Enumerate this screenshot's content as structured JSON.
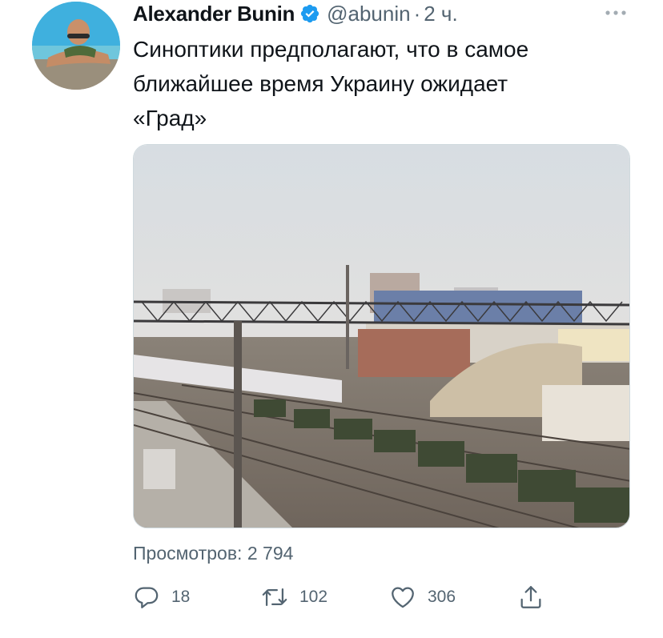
{
  "tweet": {
    "author_name": "Alexander Bunin",
    "handle": "@abunin",
    "separator": "·",
    "time": "2 ч.",
    "text": "Синоптики предполагают, что в самое\nближайшее время Украину ожидает\n«Град»",
    "views_label": "Просмотров:",
    "views_count": "2 794"
  },
  "actions": {
    "reply_count": "18",
    "retweet_count": "102",
    "like_count": "306"
  },
  "icons": {
    "verified": "verified-badge-icon",
    "more": "more-dots-icon",
    "reply": "reply-bubble-icon",
    "retweet": "retweet-arrows-icon",
    "like": "heart-icon",
    "share": "share-upload-icon"
  },
  "colors": {
    "text_primary": "#0f1419",
    "text_secondary": "#536471",
    "verified_blue": "#1d9bf0",
    "border": "#cfd9de"
  }
}
